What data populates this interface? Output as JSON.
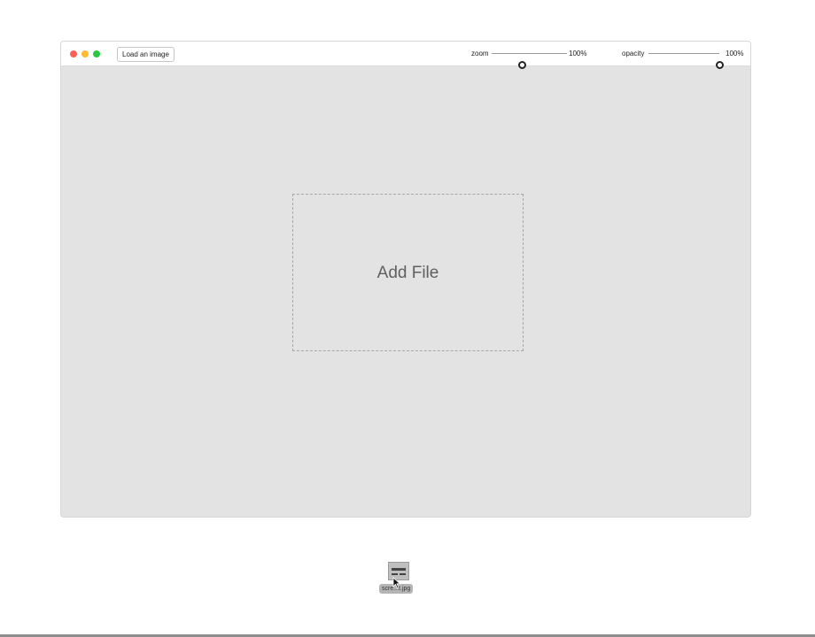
{
  "toolbar": {
    "load_button_label": "Load an image",
    "zoom": {
      "label": "zoom",
      "value_text": "100%",
      "level": 0.4
    },
    "opacity": {
      "label": "opacity",
      "value_text": "100%",
      "level": 1.0
    }
  },
  "drop_zone": {
    "label": "Add File"
  },
  "dragged_file": {
    "name": "scre...t.jpg",
    "icon": "image-file-icon"
  },
  "colors": {
    "close": "#fc5f57",
    "minimize": "#fdbb2e",
    "maximize": "#28c840",
    "canvas": "#e3e3e3"
  }
}
